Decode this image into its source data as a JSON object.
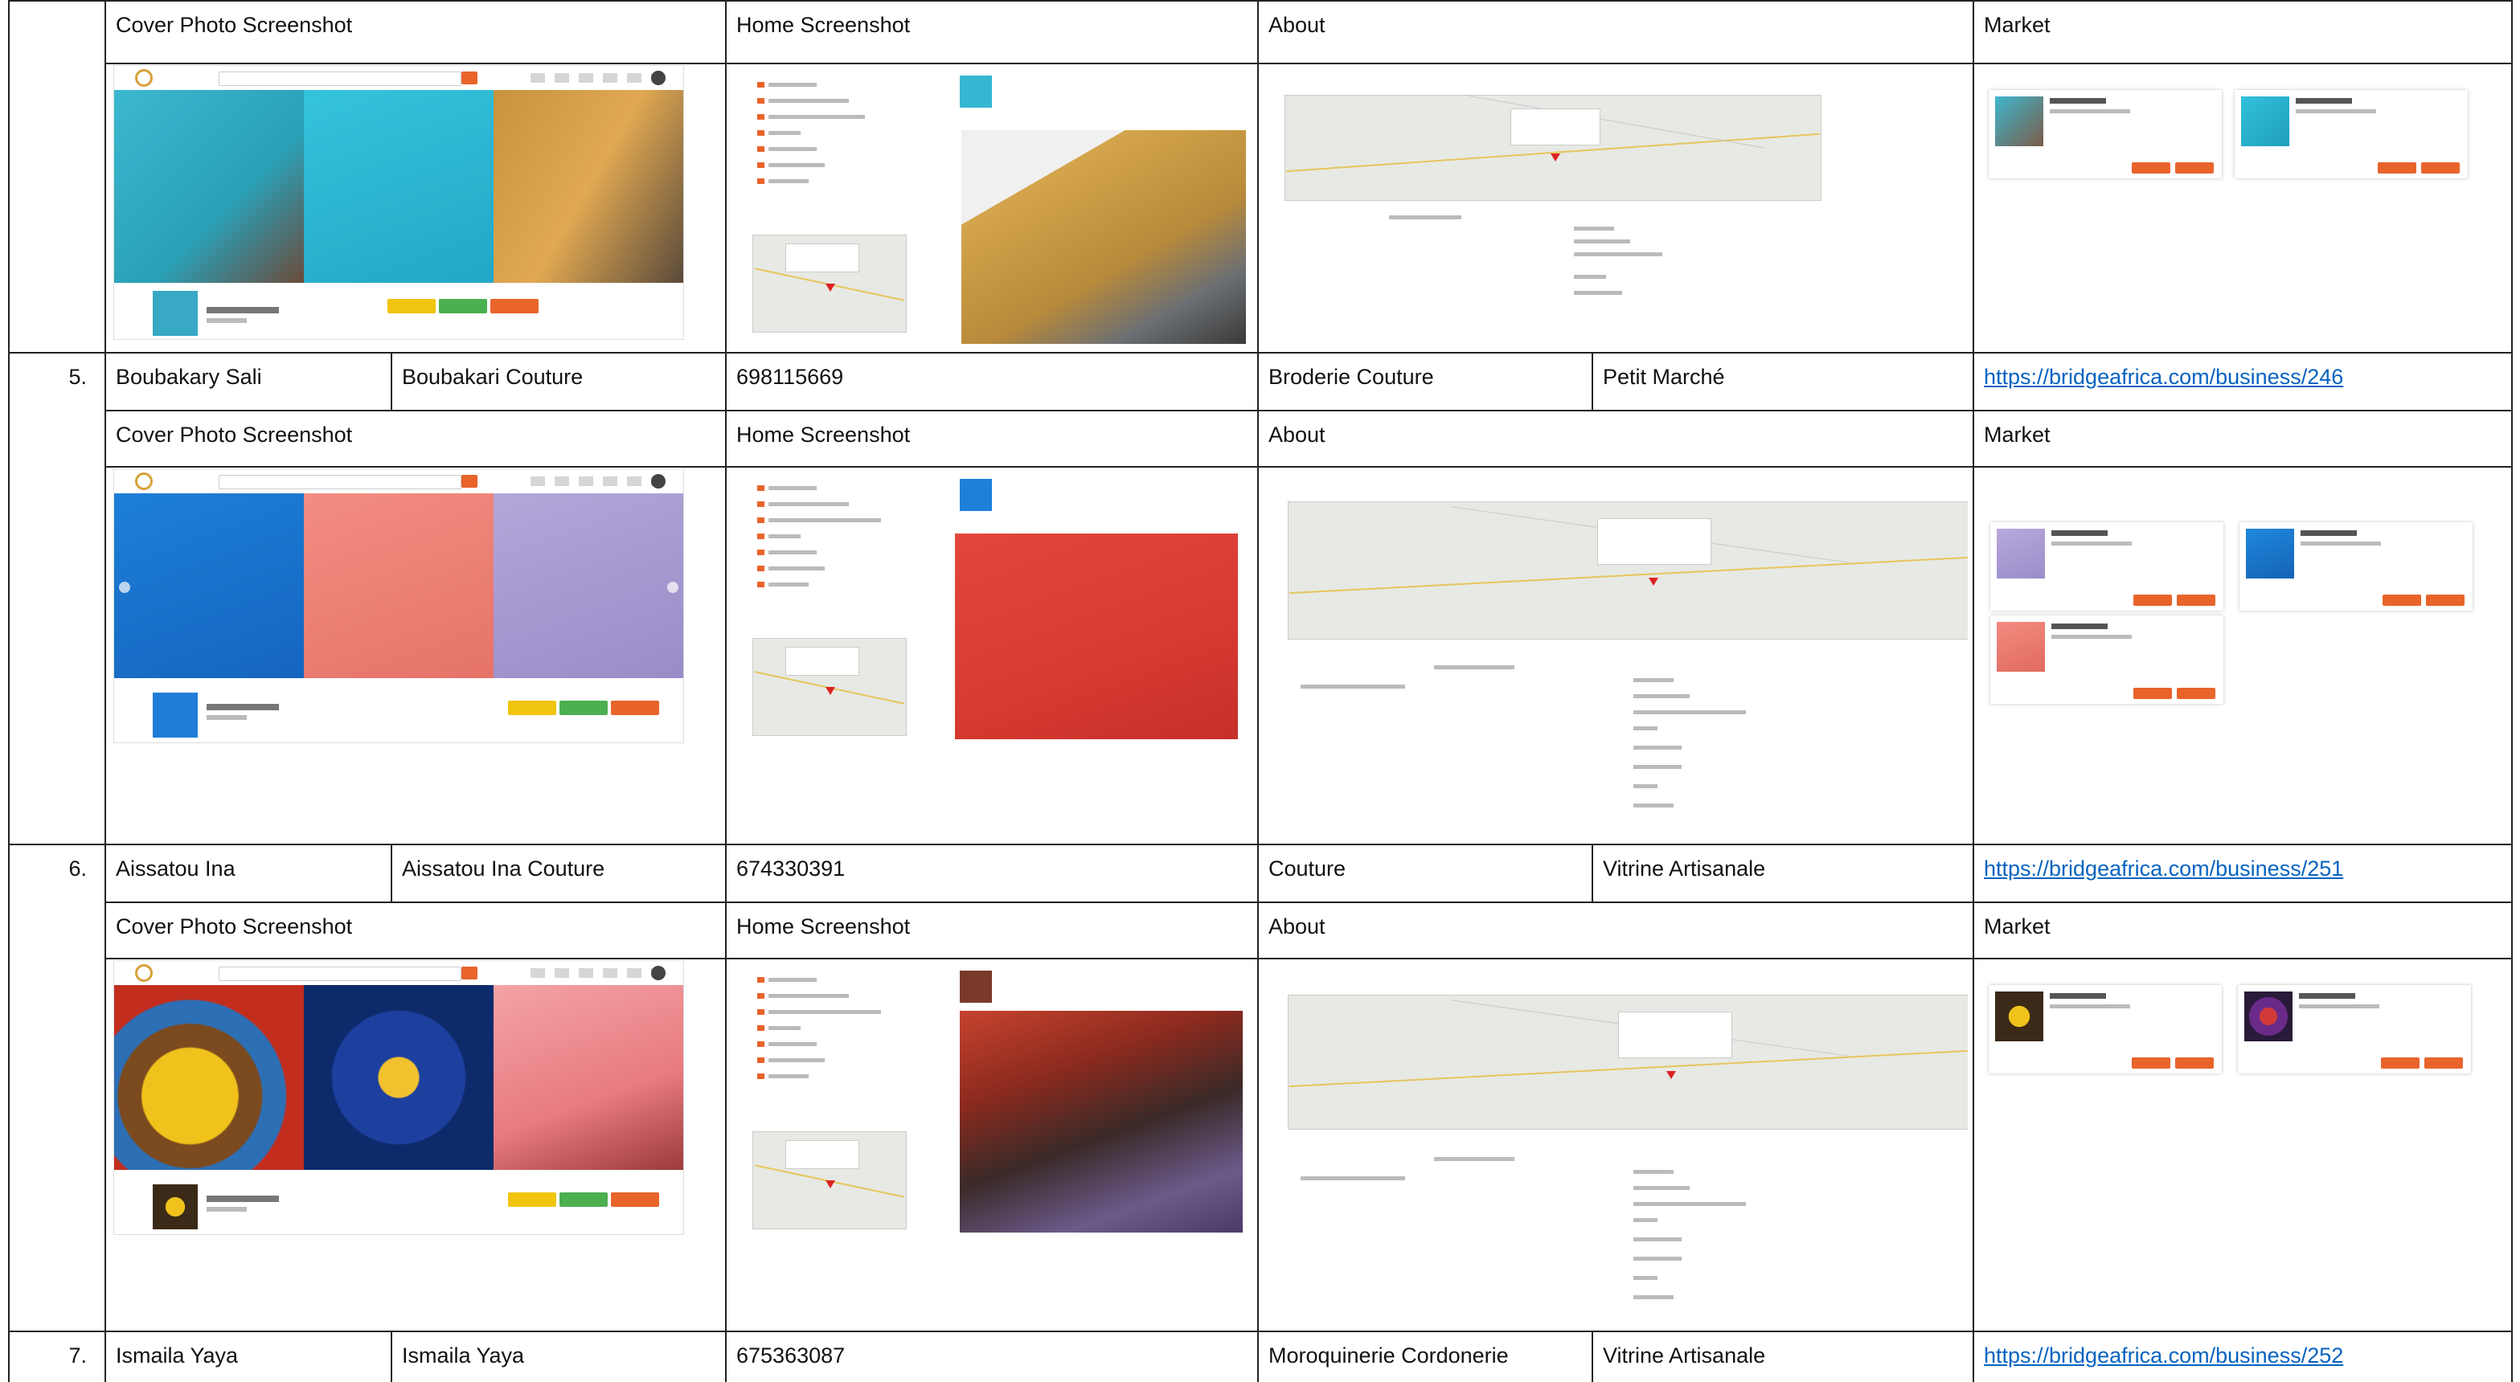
{
  "section_labels": {
    "cover": "Cover Photo Screenshot",
    "home": "Home Screenshot",
    "about": "About",
    "market": "Market"
  },
  "rows": [
    {
      "number": "5.",
      "name": "Boubakary Sali",
      "business": "Boubakari Couture",
      "phone": "698115669",
      "category": "Broderie Couture",
      "market": "Petit Marché",
      "url": "https://bridgeafrica.com/business/246"
    },
    {
      "number": "6.",
      "name": "Aissatou Ina",
      "business": "Aissatou Ina Couture",
      "phone": "674330391",
      "category": "Couture",
      "market": "Vitrine Artisanale",
      "url": "https://bridgeafrica.com/business/251"
    },
    {
      "number": "7.",
      "name": "Ismaila Yaya",
      "business": "Ismaila Yaya",
      "phone": "675363087",
      "category": "Moroquinerie Cordonerie",
      "market": "Vitrine Artisanale",
      "url": "https://bridgeafrica.com/business/252"
    }
  ],
  "colors": {
    "accent": "#e8642b",
    "link": "#0563c1"
  }
}
